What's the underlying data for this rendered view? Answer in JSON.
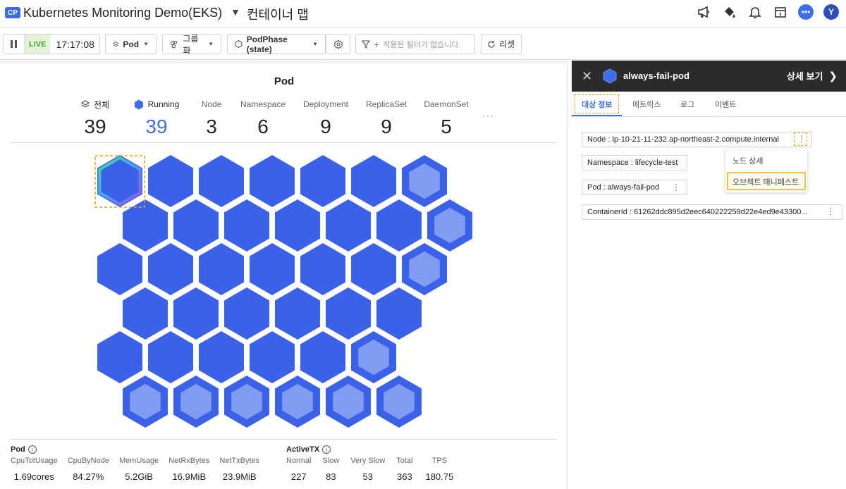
{
  "header": {
    "badge": "CP",
    "project_title": "Kubernetes Monitoring Demo(EKS)",
    "page_title": "컨테이너 맵",
    "avatar_initial": "Y"
  },
  "toolbar": {
    "live_label": "LIVE",
    "time": "17:17:08",
    "view_select": "Pod",
    "group_select": "그룹화",
    "phase_select": "PodPhase (state)",
    "filter_placeholder": "적용된 필터가 없습니다.",
    "reset_label": "리셋"
  },
  "main": {
    "title": "Pod",
    "summary": [
      {
        "label": "전체",
        "value": "39"
      },
      {
        "label": "Running",
        "value": "39"
      },
      {
        "label": "Node",
        "value": "3"
      },
      {
        "label": "Namespace",
        "value": "6"
      },
      {
        "label": "Deployment",
        "value": "9"
      },
      {
        "label": "ReplicaSet",
        "value": "9"
      },
      {
        "label": "DaemonSet",
        "value": "5"
      }
    ],
    "pod_count": 39,
    "colors": {
      "hex_fill": "#3a61e8",
      "hex_inner": "#7f9cf0",
      "accent": "#3f6de8"
    }
  },
  "metrics": {
    "pod": {
      "title": "Pod",
      "items": [
        {
          "label": "CpuTotUsage",
          "value": "1.69cores"
        },
        {
          "label": "CpuByNode",
          "value": "84.27%"
        },
        {
          "label": "MemUsage",
          "value": "5.2GiB"
        },
        {
          "label": "NetRxBytes",
          "value": "16.9MiB"
        },
        {
          "label": "NetTxBytes",
          "value": "23.9MiB"
        }
      ]
    },
    "activetx": {
      "title": "ActiveTX",
      "items": [
        {
          "label": "Normal",
          "value": "227"
        },
        {
          "label": "Slow",
          "value": "83"
        },
        {
          "label": "Very Slow",
          "value": "53"
        },
        {
          "label": "Total",
          "value": "363"
        },
        {
          "label": "TPS",
          "value": "180.75"
        }
      ]
    }
  },
  "side": {
    "pod_name": "always-fail-pod",
    "detail_link": "상세 보기",
    "tabs": [
      "대상 정보",
      "메트릭스",
      "로그",
      "이벤트"
    ],
    "info": {
      "node": "Node : ip-10-21-11-232.ap-northeast-2.compute.internal",
      "namespace": "Namespace : lifecycle-test",
      "pod": "Pod : always-fail-pod",
      "container": "ContainerId : 61262ddc895d2eec640222259d22e4ed9e43300..."
    },
    "menu": [
      "노드 상세",
      "오브젝트 매니페스트"
    ]
  }
}
